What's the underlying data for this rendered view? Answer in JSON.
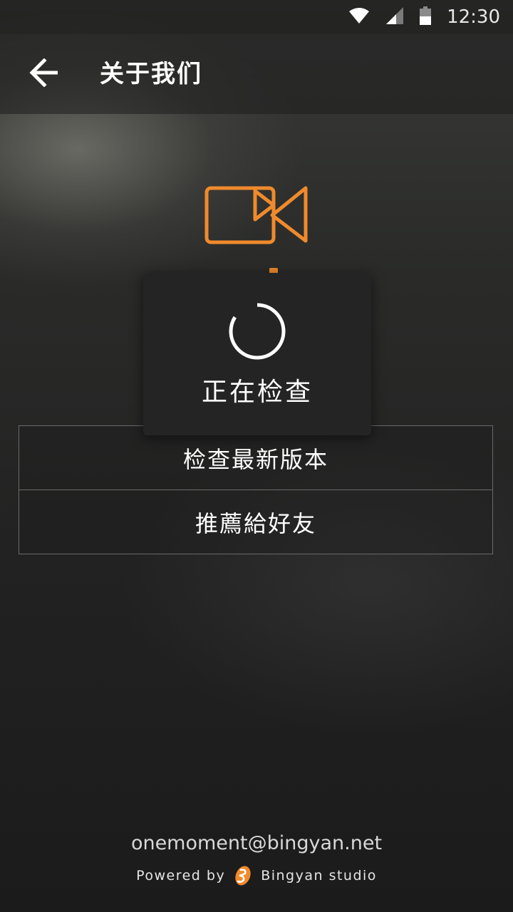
{
  "status_bar": {
    "time": "12:30",
    "icons": [
      "wifi-icon",
      "cellular-signal-icon",
      "battery-icon"
    ]
  },
  "app_bar": {
    "back_icon": "arrow-left-icon",
    "title": "关于我们"
  },
  "logo": {
    "icon": "video-camera-icon",
    "accent_color": "#F08A2C"
  },
  "dialog": {
    "message": "正在检查",
    "spinner_icon": "loading-spinner-icon"
  },
  "menu": {
    "items": [
      {
        "label": "检查最新版本"
      },
      {
        "label": "推薦給好友"
      }
    ]
  },
  "footer": {
    "email": "onemoment@bingyan.net",
    "powered_prefix": "Powered by",
    "studio_name": "Bingyan studio",
    "studio_icon": "bingyan-logo-icon"
  },
  "colors": {
    "accent": "#F08A2C",
    "text": "#FFFFFF",
    "divider": "#6A6A6A"
  }
}
